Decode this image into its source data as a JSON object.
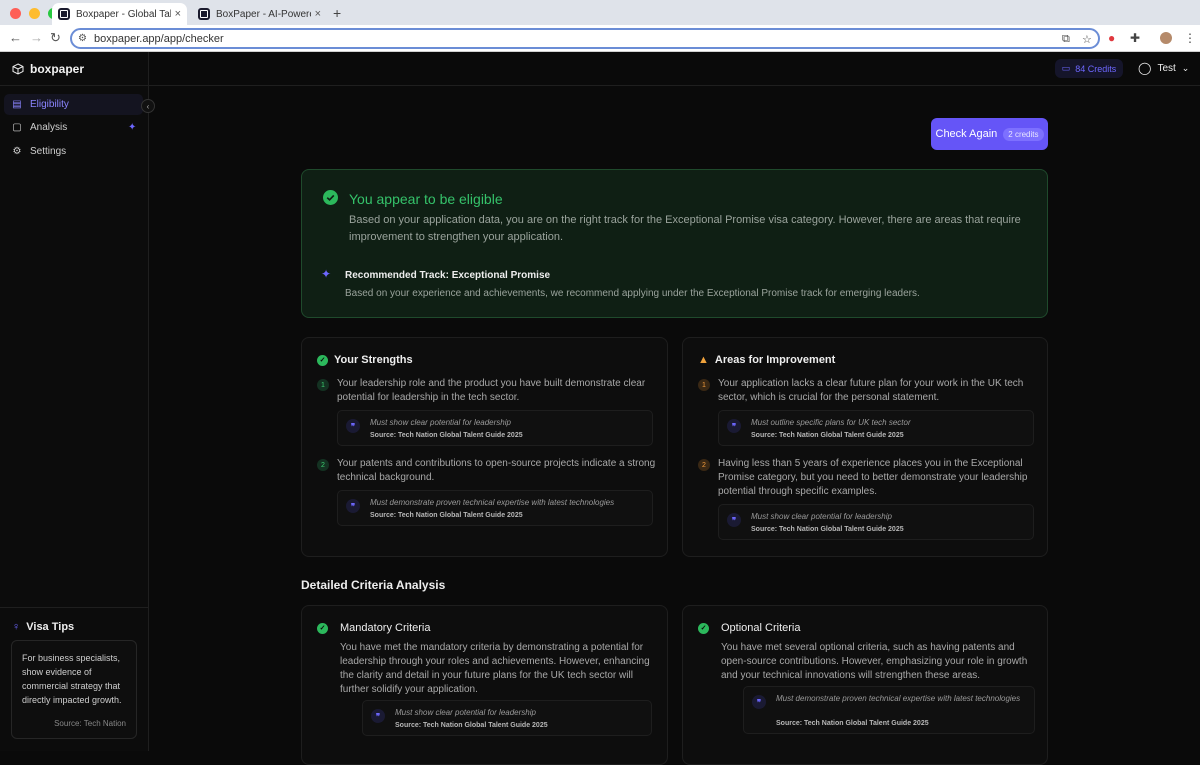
{
  "browser": {
    "tabs": [
      {
        "title": "Boxpaper - Global Talent Visa",
        "close": "×"
      },
      {
        "title": "BoxPaper - AI-Powered Documents",
        "close": "×"
      }
    ],
    "new_tab": "+",
    "url": "boxpaper.app/app/checker"
  },
  "sidebar": {
    "brand": "boxpaper",
    "items": [
      {
        "label": "Eligibility",
        "icon": "document-icon"
      },
      {
        "label": "Analysis",
        "icon": "file-icon"
      },
      {
        "label": "Settings",
        "icon": "gear-icon"
      }
    ],
    "tips": {
      "title": "Visa Tips",
      "text": "For business specialists, show evidence of commercial strategy that directly impacted growth.",
      "source": "Source: Tech Nation"
    }
  },
  "header": {
    "credits": "84 Credits",
    "user": "Test"
  },
  "check_again": {
    "label": "Check Again",
    "credits": "2 credits"
  },
  "eligibility": {
    "title": "You appear to be eligible",
    "description": "Based on your application data, you are on the right track for the Exceptional Promise visa category. However, there are areas that require improvement to strengthen your application.",
    "track_title": "Recommended Track: Exceptional Promise",
    "track_desc": "Based on your experience and achievements, we recommend applying under the Exceptional Promise track for emerging leaders."
  },
  "strengths": {
    "title": "Your Strengths",
    "items": [
      {
        "num": "1",
        "text": "Your leadership role and the product you have built demonstrate clear potential for leadership in the tech sector.",
        "quote": "Must show clear potential for leadership",
        "source": "Source: Tech Nation Global Talent Guide 2025"
      },
      {
        "num": "2",
        "text": "Your patents and contributions to open-source projects indicate a strong technical background.",
        "quote": "Must demonstrate proven technical expertise with latest technologies",
        "source": "Source: Tech Nation Global Talent Guide 2025"
      }
    ]
  },
  "improvements": {
    "title": "Areas for Improvement",
    "items": [
      {
        "num": "1",
        "text": "Your application lacks a clear future plan for your work in the UK tech sector, which is crucial for the personal statement.",
        "quote": "Must outline specific plans for UK tech sector",
        "source": "Source: Tech Nation Global Talent Guide 2025"
      },
      {
        "num": "2",
        "text": "Having less than 5 years of experience places you in the Exceptional Promise category, but you need to better demonstrate your leadership potential through specific examples.",
        "quote": "Must show clear potential for leadership",
        "source": "Source: Tech Nation Global Talent Guide 2025"
      }
    ]
  },
  "criteria": {
    "title": "Detailed Criteria Analysis",
    "mandatory": {
      "title": "Mandatory Criteria",
      "text": "You have met the mandatory criteria by demonstrating a potential for leadership through your roles and achievements. However, enhancing the clarity and detail in your future plans for the UK tech sector will further solidify your application.",
      "quote": "Must show clear potential for leadership",
      "source": "Source: Tech Nation Global Talent Guide 2025"
    },
    "optional": {
      "title": "Optional Criteria",
      "text": "You have met several optional criteria, such as having patents and open-source contributions. However, emphasizing your role in growth and your technical innovations will strengthen these areas.",
      "quote": "Must demonstrate proven technical expertise with latest technologies",
      "source": "Source: Tech Nation Global Talent Guide 2025"
    }
  }
}
